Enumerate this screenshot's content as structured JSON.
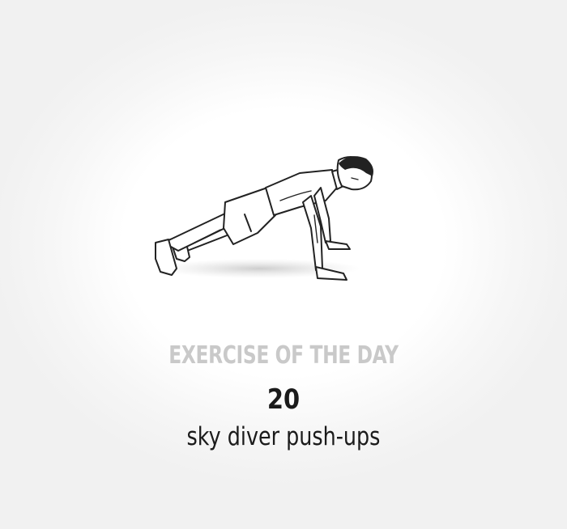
{
  "exercise": {
    "kicker": "EXERCISE OF THE DAY",
    "count": "20",
    "name": "sky diver push-ups"
  },
  "illustration": {
    "icon": "push-up-figure-icon"
  },
  "colors": {
    "kicker": "#c9c9c9",
    "text": "#1b1b1b",
    "background": "#ffffff"
  }
}
